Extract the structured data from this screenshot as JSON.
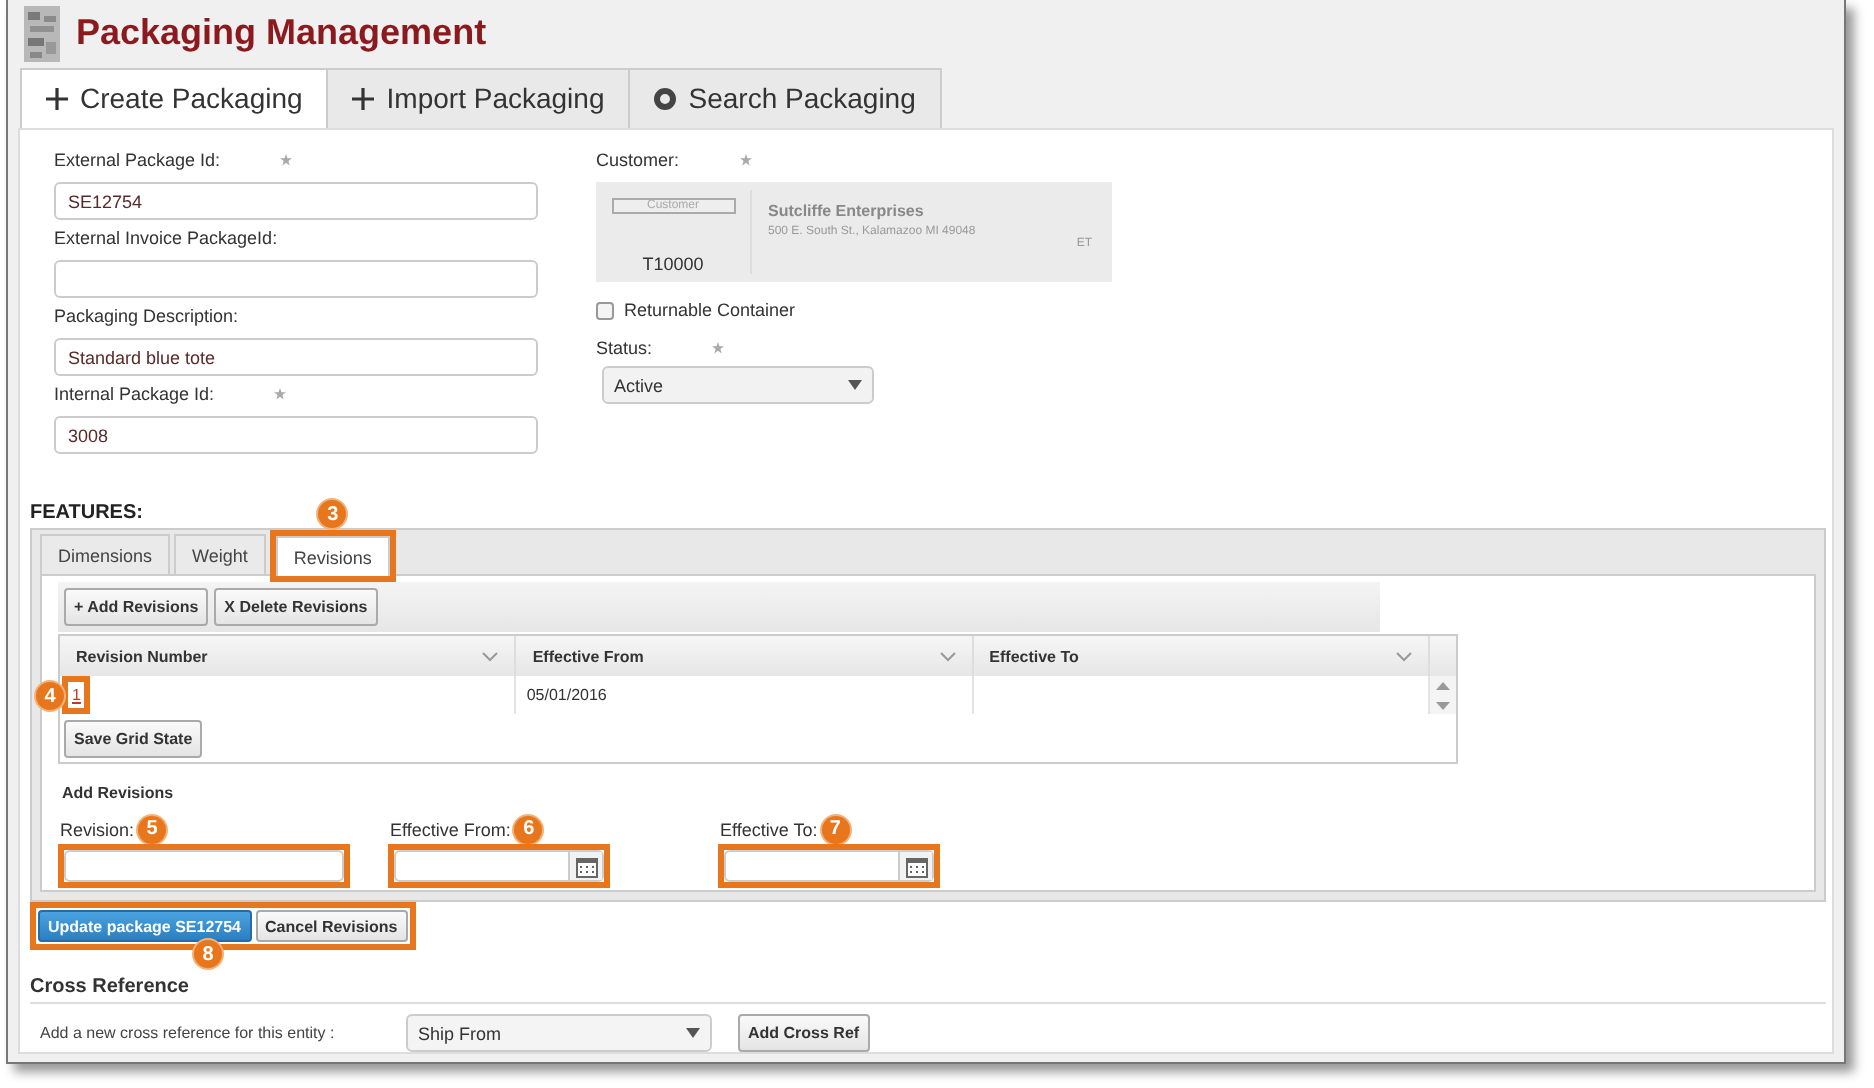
{
  "header": {
    "title": "Packaging Management"
  },
  "tabs": [
    {
      "label": "Create Packaging",
      "kind": "add",
      "selected": true
    },
    {
      "label": "Import Packaging",
      "kind": "add",
      "selected": false
    },
    {
      "label": "Search Packaging",
      "kind": "search",
      "selected": false
    }
  ],
  "left_fields": [
    {
      "label": "External Package Id:",
      "required": true,
      "value": "SE12754"
    },
    {
      "label": "External Invoice PackageId:",
      "required": false
    },
    {
      "label": "Packaging Description:",
      "required": false,
      "value": "Standard blue tote"
    },
    {
      "label": "Internal Package Id:",
      "required": true,
      "value": "3008"
    }
  ],
  "customer": {
    "label": "Customer:",
    "required": true,
    "button": "Customer",
    "code": "T10000",
    "name": "Sutcliffe Enterprises",
    "address": "500 E. South St., Kalamazoo MI 49048",
    "tag": "ET"
  },
  "returnable": {
    "label": "Returnable Container",
    "checked": false
  },
  "status": {
    "label": "Status:",
    "required": true,
    "value": "Active"
  },
  "features": {
    "heading": "FEATURES:",
    "tabs": [
      {
        "label": "Dimensions",
        "selected": false
      },
      {
        "label": "Weight",
        "selected": false
      },
      {
        "label": "Revisions",
        "selected": true,
        "callout": "3"
      }
    ],
    "toolbar": [
      "+ Add Revisions",
      "X Delete Revisions"
    ],
    "columns": [
      "Revision Number",
      "Effective From",
      "Effective To"
    ],
    "rows": [
      {
        "revision": "1",
        "effective_from": "05/01/2016",
        "callout": "4"
      }
    ],
    "save_button": "Save Grid State",
    "add_heading": "Add Revisions",
    "fields": [
      {
        "kind": "text",
        "label": "Revision:",
        "callout": "5"
      },
      {
        "kind": "date",
        "label": "Effective From:",
        "callout": "6"
      },
      {
        "kind": "date",
        "label": "Effective To:",
        "callout": "7"
      }
    ]
  },
  "actions": {
    "callout": "8",
    "buttons": [
      {
        "label": "Update package SE12754",
        "primary": true
      },
      {
        "label": "Cancel Revisions",
        "primary": false
      }
    ]
  },
  "cross_reference": {
    "heading": "Cross Reference",
    "prompt": "Add a new cross reference for this entity :",
    "select": "Ship From",
    "button": "Add Cross Ref"
  }
}
